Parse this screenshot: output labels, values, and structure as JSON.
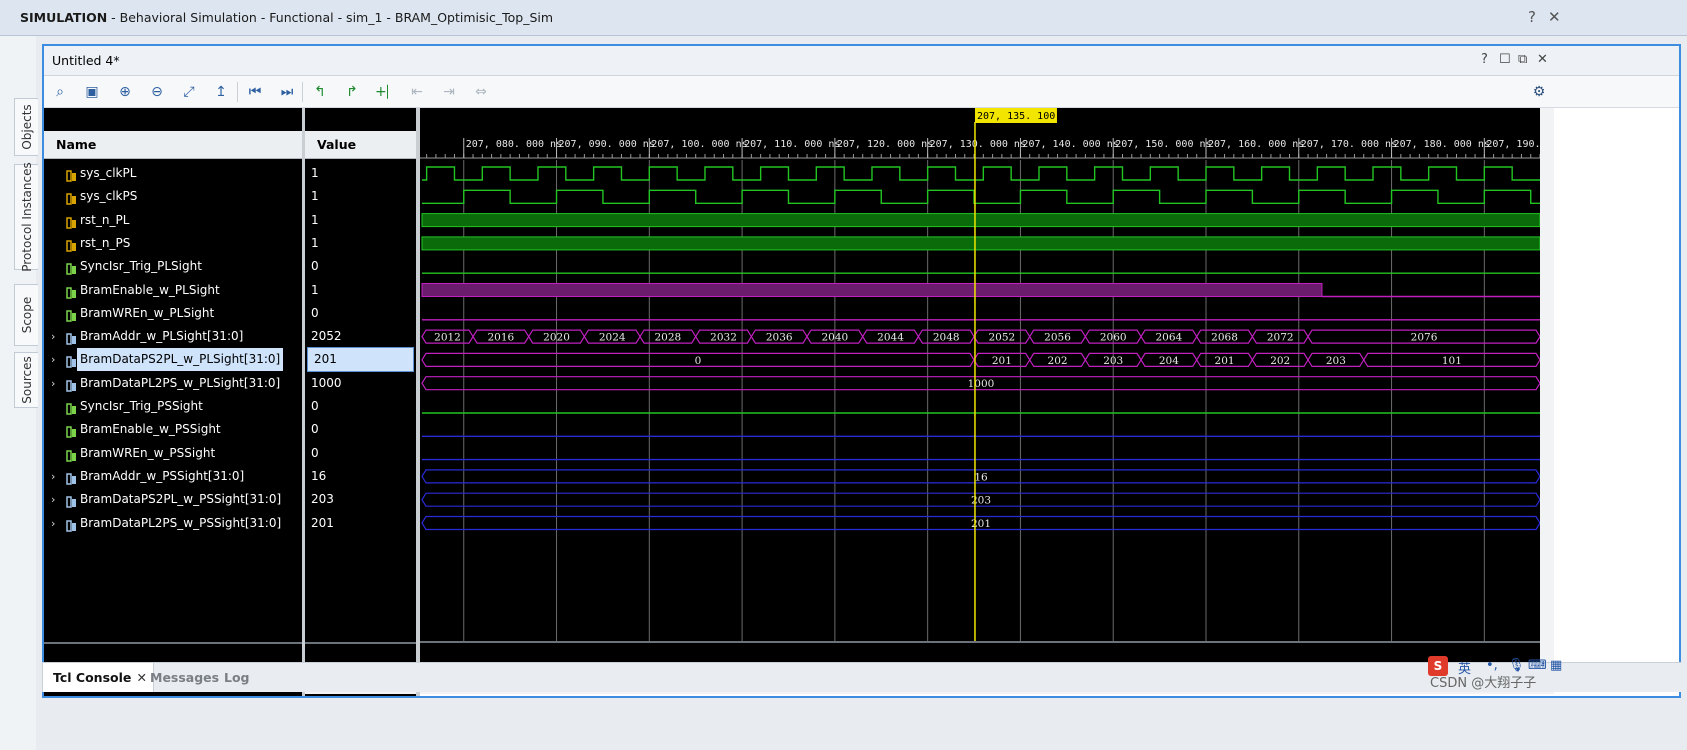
{
  "window": {
    "title_strong": "SIMULATION",
    "title_rest": " - Behavioral Simulation - Functional - sim_1 - BRAM_Optimisic_Top_Sim",
    "help_label": "?",
    "close_label": "✕"
  },
  "side_tabs": [
    "Objects",
    "Protocol Instances",
    "Scope",
    "Sources"
  ],
  "panel": {
    "title": "Untitled 4*",
    "buttons": [
      "?",
      "☐",
      "⧉",
      "✕"
    ]
  },
  "toolbar": {
    "tools": [
      "search-icon",
      "save-icon",
      "zoom-in-icon",
      "zoom-out-icon",
      "zoom-fit-icon",
      "goto-cursor-icon",
      "goto-start-icon",
      "goto-end-icon",
      "prev-transition-icon",
      "next-transition-icon",
      "add-marker-icon",
      "prev-marker-icon",
      "next-marker-icon",
      "swap-cursor-icon",
      "settings-icon"
    ]
  },
  "columns": {
    "name": "Name",
    "value": "Value"
  },
  "signals": [
    {
      "name": "sys_clkPL",
      "value": "1",
      "kind": "bit",
      "expandable": false
    },
    {
      "name": "sys_clkPS",
      "value": "1",
      "kind": "bit",
      "expandable": false
    },
    {
      "name": "rst_n_PL",
      "value": "1",
      "kind": "bit",
      "expandable": false
    },
    {
      "name": "rst_n_PS",
      "value": "1",
      "kind": "bit",
      "expandable": false
    },
    {
      "name": "SyncIsr_Trig_PLSight",
      "value": "0",
      "kind": "wire",
      "expandable": false
    },
    {
      "name": "BramEnable_w_PLSight",
      "value": "1",
      "kind": "wire",
      "expandable": false
    },
    {
      "name": "BramWREn_w_PLSight",
      "value": "0",
      "kind": "wire",
      "expandable": false
    },
    {
      "name": "BramAddr_w_PLSight[31:0]",
      "value": "2052",
      "kind": "bus",
      "expandable": true
    },
    {
      "name": "BramDataPS2PL_w_PLSight[31:0]",
      "value": "201",
      "kind": "bus",
      "expandable": true,
      "selected": true
    },
    {
      "name": "BramDataPL2PS_w_PLSight[31:0]",
      "value": "1000",
      "kind": "bus",
      "expandable": true
    },
    {
      "name": "SyncIsr_Trig_PSSight",
      "value": "0",
      "kind": "wire",
      "expandable": false
    },
    {
      "name": "BramEnable_w_PSSight",
      "value": "0",
      "kind": "wire",
      "expandable": false
    },
    {
      "name": "BramWREn_w_PSSight",
      "value": "0",
      "kind": "wire",
      "expandable": false
    },
    {
      "name": "BramAddr_w_PSSight[31:0]",
      "value": "16",
      "kind": "bus",
      "expandable": true
    },
    {
      "name": "BramDataPS2PL_w_PSSight[31:0]",
      "value": "203",
      "kind": "bus",
      "expandable": true
    },
    {
      "name": "BramDataPL2PS_w_PSSight[31:0]",
      "value": "201",
      "kind": "bus",
      "expandable": true
    }
  ],
  "chart_data": {
    "type": "line",
    "title": "",
    "xlabel": "",
    "ylabel": "",
    "time_unit": "ns",
    "x_ticks": [
      "207, 080. 000 ns",
      "207, 090. 000 ns",
      "207, 100. 000 ns",
      "207, 110. 000 ns",
      "207, 120. 000 ns",
      "207, 130. 000 ns",
      "207, 140. 000 ns",
      "207, 150. 000 ns",
      "207, 160. 000 ns",
      "207, 170. 000 ns",
      "207, 180. 000 ns",
      "207, 190. 00"
    ],
    "x_tick_values": [
      207080,
      207090,
      207100,
      207110,
      207120,
      207130,
      207140,
      207150,
      207160,
      207170,
      207180,
      207190
    ],
    "xlim": [
      207075.5,
      207196.0
    ],
    "cursor": {
      "time": 207135.1,
      "label": "207, 135. 100 ns"
    },
    "grid": true,
    "series": [
      {
        "name": "sys_clkPL",
        "kind": "clock",
        "period": 6.0,
        "edges_from": 207076.0,
        "color": "#22c422"
      },
      {
        "name": "sys_clkPS",
        "kind": "clock",
        "period": 10.0,
        "edges_from": 207080.0,
        "color": "#22c422"
      },
      {
        "name": "rst_n_PL",
        "kind": "high",
        "color": "#22c422"
      },
      {
        "name": "rst_n_PS",
        "kind": "high",
        "color": "#22c422"
      },
      {
        "name": "SyncIsr_Trig_PLSight",
        "kind": "low",
        "color": "#22c422"
      },
      {
        "name": "BramEnable_w_PLSight",
        "kind": "enable",
        "fall": 207172.5,
        "color": "#c020c0"
      },
      {
        "name": "BramWREn_w_PLSight",
        "kind": "low",
        "color": "#c020c0"
      },
      {
        "name": "BramAddr_w_PLSight[31:0]",
        "kind": "bus",
        "color": "#c020c0",
        "values": [
          {
            "t0": 207075.5,
            "t1": 207081.0,
            "v": "2012"
          },
          {
            "t0": 207081.0,
            "t1": 207087.0,
            "v": "2016"
          },
          {
            "t0": 207087.0,
            "t1": 207093.0,
            "v": "2020"
          },
          {
            "t0": 207093.0,
            "t1": 207099.0,
            "v": "2024"
          },
          {
            "t0": 207099.0,
            "t1": 207105.0,
            "v": "2028"
          },
          {
            "t0": 207105.0,
            "t1": 207111.0,
            "v": "2032"
          },
          {
            "t0": 207111.0,
            "t1": 207117.0,
            "v": "2036"
          },
          {
            "t0": 207117.0,
            "t1": 207123.0,
            "v": "2040"
          },
          {
            "t0": 207123.0,
            "t1": 207129.0,
            "v": "2044"
          },
          {
            "t0": 207129.0,
            "t1": 207135.0,
            "v": "2048"
          },
          {
            "t0": 207135.0,
            "t1": 207141.0,
            "v": "2052"
          },
          {
            "t0": 207141.0,
            "t1": 207147.0,
            "v": "2056"
          },
          {
            "t0": 207147.0,
            "t1": 207153.0,
            "v": "2060"
          },
          {
            "t0": 207153.0,
            "t1": 207159.0,
            "v": "2064"
          },
          {
            "t0": 207159.0,
            "t1": 207165.0,
            "v": "2068"
          },
          {
            "t0": 207165.0,
            "t1": 207171.0,
            "v": "2072"
          },
          {
            "t0": 207171.0,
            "t1": 207196.0,
            "v": "2076"
          }
        ]
      },
      {
        "name": "BramDataPS2PL_w_PLSight[31:0]",
        "kind": "bus",
        "color": "#c020c0",
        "values": [
          {
            "t0": 207075.5,
            "t1": 207135.0,
            "v": "0"
          },
          {
            "t0": 207135.0,
            "t1": 207141.0,
            "v": "201"
          },
          {
            "t0": 207141.0,
            "t1": 207147.0,
            "v": "202"
          },
          {
            "t0": 207147.0,
            "t1": 207153.0,
            "v": "203"
          },
          {
            "t0": 207153.0,
            "t1": 207159.0,
            "v": "204"
          },
          {
            "t0": 207159.0,
            "t1": 207165.0,
            "v": "201"
          },
          {
            "t0": 207165.0,
            "t1": 207171.0,
            "v": "202"
          },
          {
            "t0": 207171.0,
            "t1": 207177.0,
            "v": "203"
          },
          {
            "t0": 207177.0,
            "t1": 207196.0,
            "v": "101"
          }
        ]
      },
      {
        "name": "BramDataPL2PS_w_PLSight[31:0]",
        "kind": "bus",
        "color": "#c020c0",
        "values": [
          {
            "t0": 207075.5,
            "t1": 207196.0,
            "v": "1000"
          }
        ]
      },
      {
        "name": "SyncIsr_Trig_PSSight",
        "kind": "low",
        "color": "#22c422"
      },
      {
        "name": "BramEnable_w_PSSight",
        "kind": "low",
        "color": "#2a2ad8"
      },
      {
        "name": "BramWREn_w_PSSight",
        "kind": "low",
        "color": "#2a2ad8"
      },
      {
        "name": "BramAddr_w_PSSight[31:0]",
        "kind": "bus",
        "color": "#2a2ad8",
        "values": [
          {
            "t0": 207075.5,
            "t1": 207196.0,
            "v": "16"
          }
        ]
      },
      {
        "name": "BramDataPS2PL_w_PSSight[31:0]",
        "kind": "bus",
        "color": "#2a2ad8",
        "values": [
          {
            "t0": 207075.5,
            "t1": 207196.0,
            "v": "203"
          }
        ]
      },
      {
        "name": "BramDataPL2PS_w_PSSight[31:0]",
        "kind": "bus",
        "color": "#2a2ad8",
        "values": [
          {
            "t0": 207075.5,
            "t1": 207196.0,
            "v": "201"
          }
        ]
      }
    ]
  },
  "bottom_tabs": [
    "Tcl Console",
    "Messages",
    "Log"
  ],
  "watermark": "CSDN @大翔子子"
}
